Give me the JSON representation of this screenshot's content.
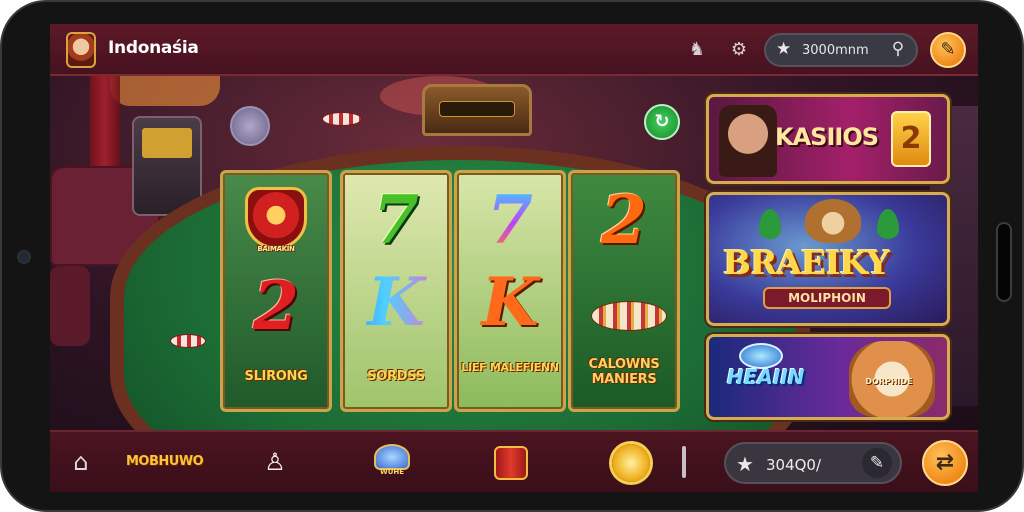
{
  "header": {
    "title": "Indonaśia",
    "icons": [
      "trophy-icon",
      "gear-icon"
    ],
    "search": {
      "text": "3000mnm",
      "star_icon": "star-icon",
      "search_icon": "search-icon"
    },
    "action_icon": "map-icon"
  },
  "reels": [
    {
      "top_label": "BAIMAKIN",
      "middle": "2",
      "bottom_label": "SLIRONG"
    },
    {
      "top": "7",
      "middle": "K",
      "bottom_label": "SORDSS"
    },
    {
      "top": "7",
      "middle": "K",
      "bottom_label": "LIEF MALEFIENN"
    },
    {
      "top": "2",
      "bottom_label": "CALOWNS MANIERS"
    }
  ],
  "cards": [
    {
      "title": "KASIIOS",
      "badge": "2"
    },
    {
      "title": "BRAEIKY",
      "subtitle": "MOLIPHOIN"
    },
    {
      "title": "HEAIIN",
      "subtitle": "DORPHIDE"
    }
  ],
  "bottom_nav": {
    "items": [
      "home-icon",
      "MOBHUWO",
      "figure-icon",
      "dome-icon",
      "drum-icon",
      "sun-icon"
    ],
    "dome_label": "WUHE",
    "balance": "304Q0/",
    "colors": {
      "accent": "#f0891a",
      "felt": "#1b6a34",
      "frame_gold": "#c9a44a"
    }
  }
}
